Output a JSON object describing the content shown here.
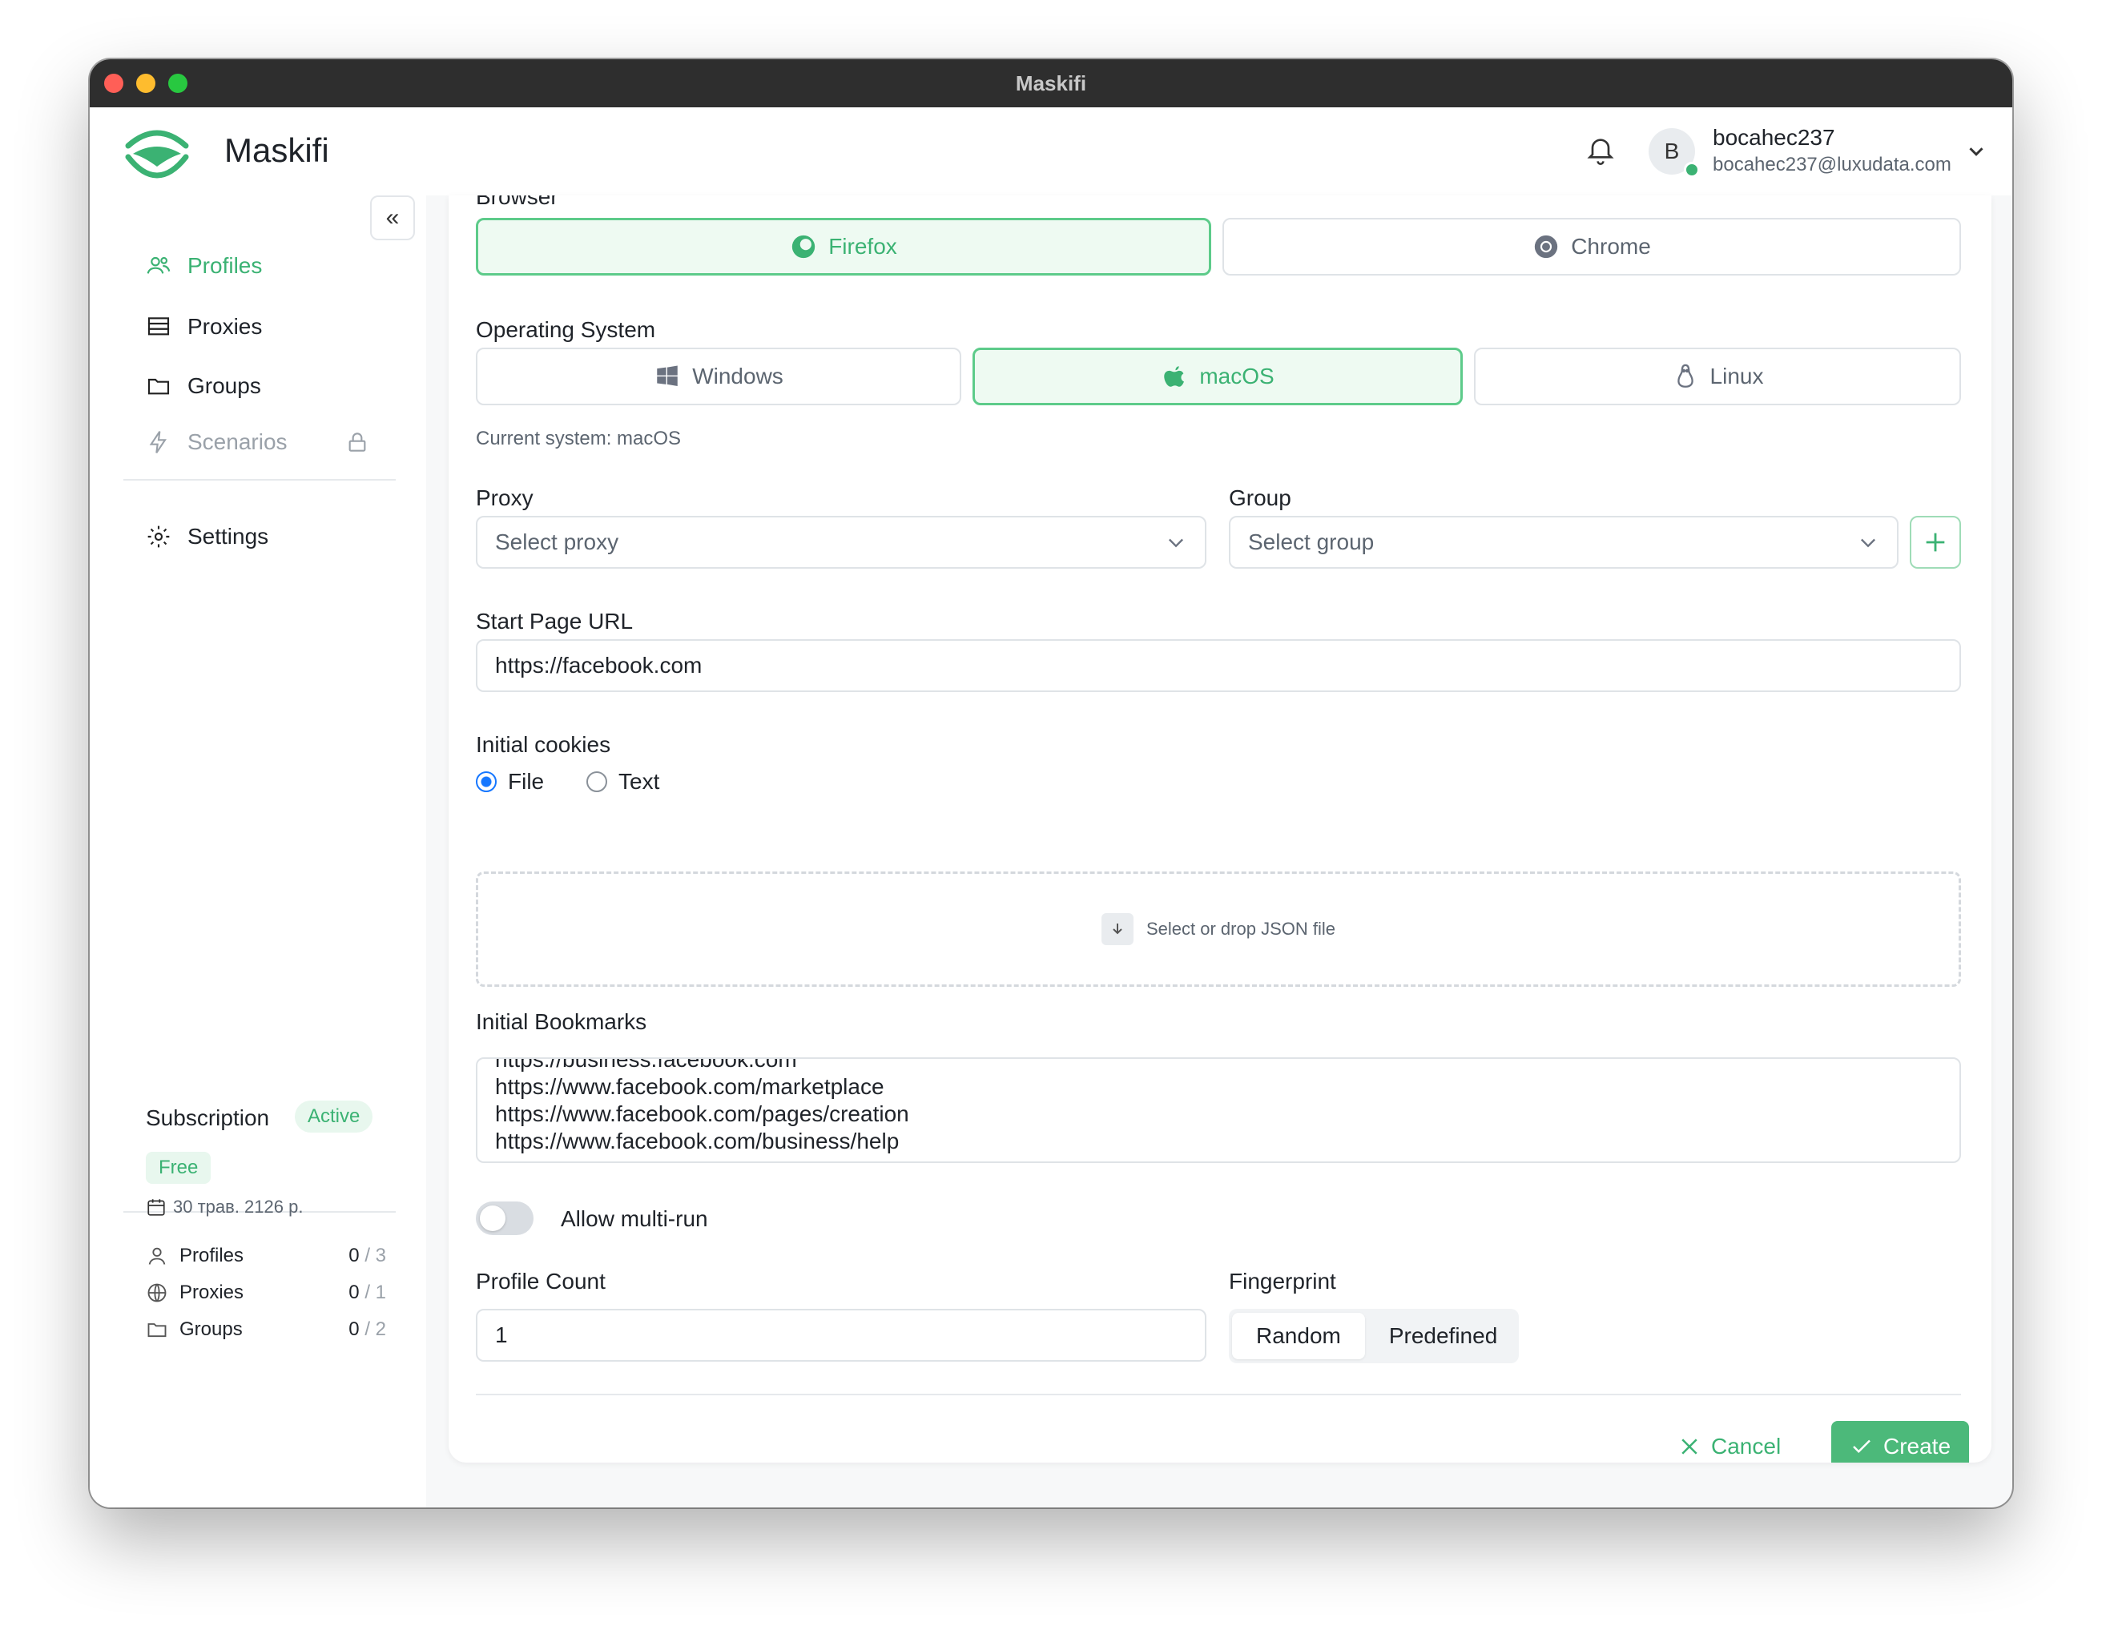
{
  "window": {
    "title": "Maskifi"
  },
  "header": {
    "app_name": "Maskifi",
    "user": {
      "initial": "B",
      "name": "bocahec237",
      "email": "bocahec237@luxudata.com"
    }
  },
  "sidebar": {
    "collapse_label": "«",
    "items": [
      {
        "label": "Profiles",
        "icon": "users-icon"
      },
      {
        "label": "Proxies",
        "icon": "server-icon"
      },
      {
        "label": "Groups",
        "icon": "folder-icon"
      },
      {
        "label": "Scenarios",
        "icon": "bolt-icon"
      },
      {
        "label": "Settings",
        "icon": "gear-icon"
      }
    ],
    "subscription": {
      "title": "Subscription",
      "status": "Active",
      "plan": "Free",
      "date": "30 трав. 2126 р.",
      "usage": [
        {
          "label": "Profiles",
          "used": "0",
          "max": "/ 3"
        },
        {
          "label": "Proxies",
          "used": "0",
          "max": "/ 1"
        },
        {
          "label": "Groups",
          "used": "0",
          "max": "/ 2"
        }
      ]
    }
  },
  "form": {
    "browser_label": "Browser",
    "browsers": [
      {
        "label": "Firefox",
        "selected": true
      },
      {
        "label": "Chrome",
        "selected": false
      }
    ],
    "os_label": "Operating System",
    "os_options": [
      {
        "label": "Windows",
        "selected": false
      },
      {
        "label": "macOS",
        "selected": true
      },
      {
        "label": "Linux",
        "selected": false
      }
    ],
    "current_system": "Current system: macOS",
    "proxy_label": "Proxy",
    "proxy_placeholder": "Select proxy",
    "group_label": "Group",
    "group_placeholder": "Select group",
    "start_url_label": "Start Page URL",
    "start_url_value": "https://facebook.com",
    "cookies_label": "Initial cookies",
    "cookies_file": "File",
    "cookies_text": "Text",
    "dropzone_text": "Select or drop JSON file",
    "bookmarks_label": "Initial Bookmarks",
    "bookmarks": [
      "https://business.facebook.com",
      "https://www.facebook.com/marketplace",
      "https://www.facebook.com/pages/creation",
      "https://www.facebook.com/business/help"
    ],
    "multirun_label": "Allow multi-run",
    "multirun_on": false,
    "profile_count_label": "Profile Count",
    "profile_count_value": "1",
    "fingerprint_label": "Fingerprint",
    "fingerprint_options": [
      "Random",
      "Predefined"
    ],
    "cancel_label": "Cancel",
    "create_label": "Create"
  },
  "colors": {
    "accent": "#3bb273",
    "selected_bg": "#eefaf2",
    "primary_button": "#4cb97a"
  }
}
